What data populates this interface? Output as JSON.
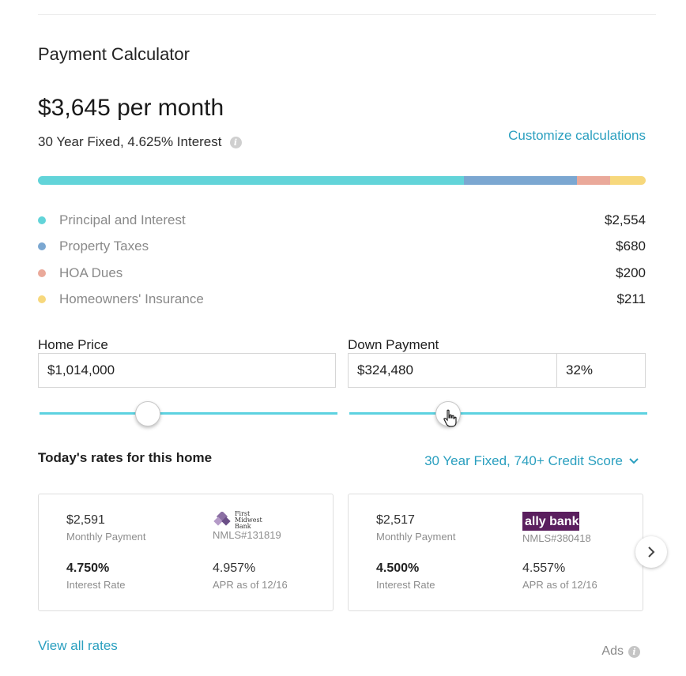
{
  "calculator": {
    "title": "Payment Calculator",
    "monthly_payment": "$3,645 per month",
    "loan_summary": "30 Year Fixed, 4.625% Interest",
    "customize_link": "Customize calculations"
  },
  "breakdown": [
    {
      "label": "Principal and Interest",
      "value": "$2,554",
      "amount": 2554,
      "color": "#62d4d9"
    },
    {
      "label": "Property Taxes",
      "value": "$680",
      "amount": 680,
      "color": "#7ba7d1"
    },
    {
      "label": "HOA Dues",
      "value": "$200",
      "amount": 200,
      "color": "#eaa99a"
    },
    {
      "label": "Homeowners' Insurance",
      "value": "$211",
      "amount": 211,
      "color": "#f7d87c"
    }
  ],
  "inputs": {
    "home_price_label": "Home Price",
    "home_price_value": "$1,014,000",
    "down_payment_label": "Down Payment",
    "down_payment_value": "$324,480",
    "down_payment_percent": "32%",
    "home_price_slider_fraction": 0.36,
    "down_payment_slider_fraction": 0.33
  },
  "rates": {
    "heading": "Today's rates for this home",
    "filter": "30 Year Fixed, 740+ Credit Score",
    "cards": [
      {
        "payment": "$2,591",
        "payment_label": "Monthly Payment",
        "lender_name": "First Midwest Bank",
        "nmls": "NMLS#131819",
        "rate": "4.750%",
        "rate_label": "Interest Rate",
        "apr": "4.957%",
        "apr_label": "APR as of 12/16"
      },
      {
        "payment": "$2,517",
        "payment_label": "Monthly Payment",
        "lender_name": "ally bank",
        "nmls": "NMLS#380418",
        "rate": "4.500%",
        "rate_label": "Interest Rate",
        "apr": "4.557%",
        "apr_label": "APR as of 12/16"
      }
    ]
  },
  "footer": {
    "view_all": "View all rates",
    "ads": "Ads"
  },
  "icons": {
    "info": "info-icon",
    "chevron": "chevron-down-icon",
    "next": "chevron-right-icon",
    "cursor": "hand-cursor-icon"
  },
  "colors": {
    "accent": "#2a9fbf",
    "slider": "#5dd2e0"
  }
}
